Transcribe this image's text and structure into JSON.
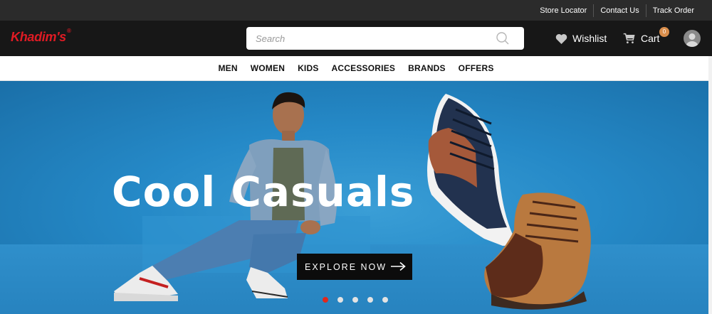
{
  "topbar": {
    "links": [
      "Store Locator",
      "Contact Us",
      "Track Order"
    ]
  },
  "header": {
    "logo_text": "Khadim's",
    "logo_mark": "®",
    "search_placeholder": "Search",
    "wishlist_label": "Wishlist",
    "cart_label": "Cart",
    "cart_count": "0",
    "icons": [
      "search-icon",
      "heart-icon",
      "cart-icon",
      "user-avatar-icon"
    ]
  },
  "nav": {
    "items": [
      "MEN",
      "WOMEN",
      "KIDS",
      "ACCESSORIES",
      "BRANDS",
      "OFFERS"
    ]
  },
  "hero": {
    "headline": "Cool Casuals",
    "cta_label": "EXPLORE NOW",
    "slides": 5,
    "active_slide": 1
  },
  "colors": {
    "topbar": "#2b2b2b",
    "header": "#171717",
    "brand_red": "#e01b24",
    "hero_blue": "#2589c7",
    "cta_black": "#0c0c0c",
    "dot_active": "#e0281d",
    "badge": "#d98e4c"
  }
}
